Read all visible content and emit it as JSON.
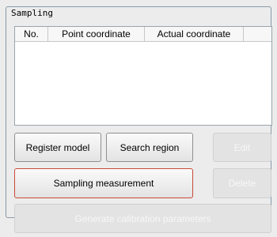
{
  "group": {
    "title": "Sampling"
  },
  "listview": {
    "columns": [
      "No.",
      "Point coordinate",
      "Actual coordinate"
    ],
    "rows": []
  },
  "buttons": {
    "register_model": "Register model",
    "search_region": "Search region",
    "edit": "Edit",
    "sampling_measurement": "Sampling measurement",
    "delete": "Delete",
    "generate_calibration": "Generate calibration parameters"
  }
}
